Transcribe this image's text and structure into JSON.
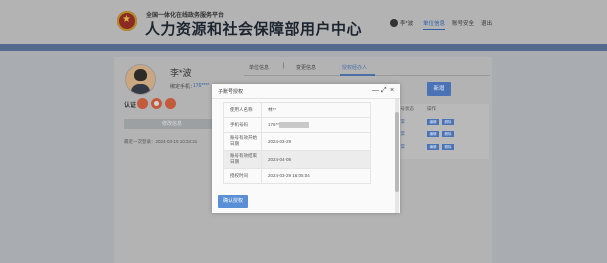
{
  "header": {
    "platform_subtitle": "全国一体化在线政务服务平台",
    "title": "人力资源和社会保障部用户中心",
    "user_display": "李*波",
    "nav": [
      "单位信息",
      "账号安全",
      "退出"
    ],
    "active_nav_index": 0
  },
  "profile": {
    "name": "李*波",
    "phone_label": "绑定手机：",
    "phone_value": "176****",
    "verify_label": "认证",
    "edit_button": "修改信息",
    "last_login": "最近一次登录：2024-03-19 10:34:31",
    "badge_colors": [
      "#c25a3c",
      "#c25a3c",
      "#c25a3c"
    ]
  },
  "tabs": {
    "items": [
      "单位信息",
      "变更信息",
      "授权经办人"
    ],
    "active_index": 2,
    "separator": "|"
  },
  "content": {
    "add_button": "新增",
    "table_headers": [
      "账号状态",
      "操作"
    ],
    "rows": [
      {
        "status": "正常",
        "actions": [
          "编辑",
          "删除"
        ]
      },
      {
        "status": "正常",
        "actions": [
          "编辑",
          "删除"
        ]
      },
      {
        "status": "正常",
        "actions": [
          "编辑",
          "删除"
        ]
      }
    ]
  },
  "modal": {
    "title": "子账号授权",
    "controls": {
      "minimize": "—",
      "maximize": "⤢",
      "close": "×"
    },
    "rows": [
      {
        "label": "使用人名称",
        "value": "林**"
      },
      {
        "label": "手机号码",
        "value": "176*****"
      },
      {
        "label": "账号有效开始日期",
        "value": "2024-03-29"
      },
      {
        "label": "账号有效结束日期",
        "value": "2024-04-08"
      },
      {
        "label": "授权时间",
        "value": "2024-03-29 16:05:04"
      }
    ],
    "confirm_button": "确认授权"
  },
  "colors": {
    "accent": "#4a72b5",
    "band": "#546a8f",
    "confirm": "#5a8fd6"
  }
}
